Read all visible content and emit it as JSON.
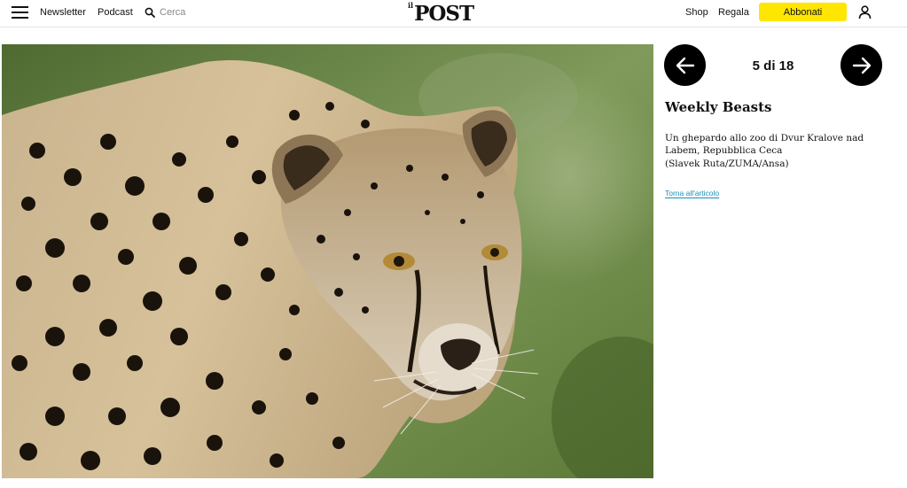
{
  "header": {
    "menu_icon": "hamburger-menu-icon",
    "newsletter_label": "Newsletter",
    "podcast_label": "Podcast",
    "search_icon": "search-icon",
    "search_placeholder": "Cerca",
    "logo_small": "il",
    "logo_main": "POST",
    "shop_label": "Shop",
    "regala_label": "Regala",
    "subscribe_label": "Abbonati",
    "subscribe_color": "#ffe600",
    "user_icon": "user-icon"
  },
  "gallery": {
    "photo_subject": "cheetah",
    "prev_icon": "arrow-left-icon",
    "next_icon": "arrow-right-icon",
    "counter": "5 di 18",
    "title": "Weekly Beasts",
    "caption": "Un ghepardo allo zoo di Dvur Kralove nad Labem, Repubblica Ceca",
    "credit": "(Slavek Ruta/ZUMA/Ansa)",
    "back_link": "Torna all'articolo",
    "link_color": "#1a8fb8"
  }
}
